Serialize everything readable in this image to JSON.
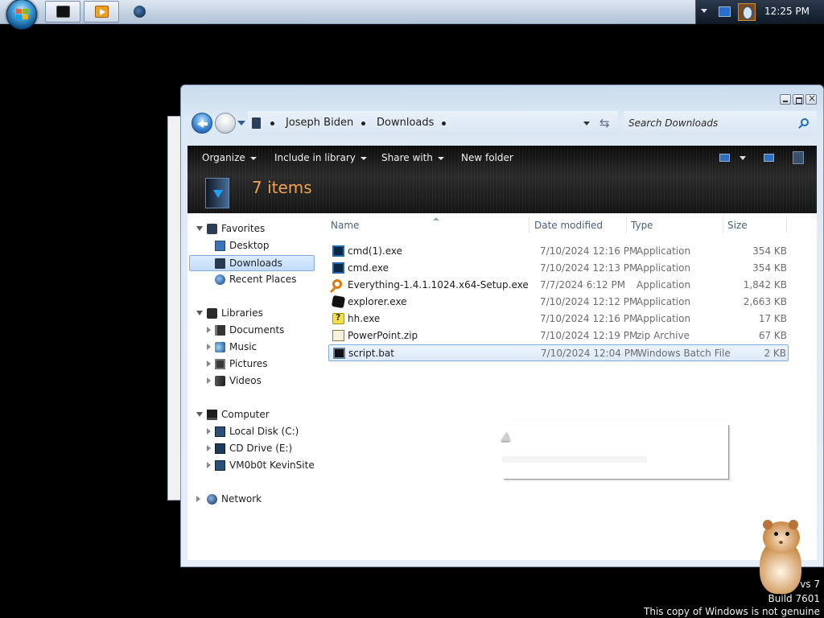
{
  "taskbar": {
    "clock": "12:25 PM",
    "buttons": [
      "terminal-icon",
      "media-player-icon"
    ],
    "colors": {
      "bar_top": "#dfe8f2",
      "tray": "#0f1826"
    }
  },
  "window": {
    "address": {
      "crumbs": [
        "Joseph Biden",
        "Downloads"
      ]
    },
    "search": {
      "placeholder": "Search Downloads"
    },
    "toolbar": {
      "organize": "Organize",
      "include_in_library": "Include in library",
      "share_with": "Share with",
      "new_folder": "New folder"
    },
    "details": {
      "item_count": "7 items"
    },
    "navigation": {
      "favorites": {
        "label": "Favorites",
        "items": [
          "Desktop",
          "Downloads",
          "Recent Places"
        ],
        "selected": "Downloads"
      },
      "libraries": {
        "label": "Libraries",
        "items": [
          "Documents",
          "Music",
          "Pictures",
          "Videos"
        ]
      },
      "computer": {
        "label": "Computer",
        "items": [
          "Local Disk (C:)",
          "CD Drive (E:)",
          "VM0b0t KevinSite"
        ]
      },
      "network": {
        "label": "Network"
      }
    },
    "columns": [
      "Name",
      "Date modified",
      "Type",
      "Size"
    ],
    "files": [
      {
        "name": "cmd(1).exe",
        "date": "7/10/2024 12:16 PM",
        "type": "Application",
        "size": "354 KB",
        "icon": "exe-icon"
      },
      {
        "name": "cmd.exe",
        "date": "7/10/2024 12:13 PM",
        "type": "Application",
        "size": "354 KB",
        "icon": "exe-icon"
      },
      {
        "name": "Everything-1.4.1.1024.x64-Setup.exe",
        "date": "7/7/2024 6:12 PM",
        "type": "Application",
        "size": "1,842 KB",
        "icon": "search-magnifier-icon"
      },
      {
        "name": "explorer.exe",
        "date": "7/10/2024 12:12 PM",
        "type": "Application",
        "size": "2,663 KB",
        "icon": "cube-icon"
      },
      {
        "name": "hh.exe",
        "date": "7/10/2024 12:16 PM",
        "type": "Application",
        "size": "17 KB",
        "icon": "help-icon"
      },
      {
        "name": "PowerPoint.zip",
        "date": "7/10/2024 12:19 PM",
        "type": "zip Archive",
        "size": "67 KB",
        "icon": "zip-icon"
      },
      {
        "name": "script.bat",
        "date": "7/10/2024 12:04 PM",
        "type": "Windows Batch File",
        "size": "2 KB",
        "icon": "batch-file-icon"
      }
    ],
    "selected_file": "script.bat",
    "colors": {
      "selection_border": "#84acdd",
      "item_count": "#f2a24e",
      "command_bar": "#1a1a1a"
    }
  },
  "watermark": {
    "line1": "vs 7",
    "line2": "Build 7601",
    "line3": "This copy of Windows is not genuine"
  }
}
